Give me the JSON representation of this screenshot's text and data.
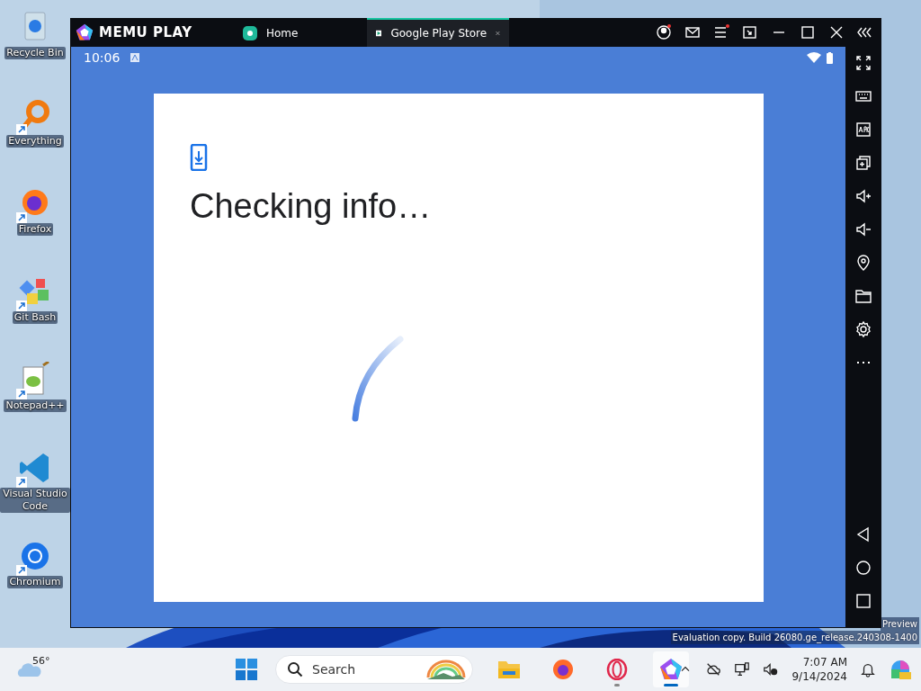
{
  "desktop_icons": [
    {
      "label": "Recycle Bin",
      "shortcut": false
    },
    {
      "label": "Everything",
      "shortcut": true
    },
    {
      "label": "Firefox",
      "shortcut": true
    },
    {
      "label": "Git Bash",
      "shortcut": true
    },
    {
      "label": "Notepad++",
      "shortcut": true
    },
    {
      "label": "Visual Studio Code",
      "shortcut": true
    },
    {
      "label": "Chromium",
      "shortcut": true
    }
  ],
  "window": {
    "logo": "MEMU PLAY",
    "tabs": [
      {
        "label": "Home",
        "selected": false,
        "closable": false
      },
      {
        "label": "Google Play Store",
        "selected": true,
        "closable": true
      }
    ],
    "android": {
      "time": "10:06",
      "dialog": {
        "title": "Checking info…"
      }
    }
  },
  "watermark_lines": [
    "Preview",
    "Evaluation copy. Build 26080.ge_release.240308-1400"
  ],
  "taskbar": {
    "weather": "56°",
    "search": {
      "placeholder": "Search"
    },
    "apps": [
      {
        "running": false,
        "active": false
      },
      {
        "running": false,
        "active": false
      },
      {
        "running": true,
        "active": false
      },
      {
        "running": true,
        "active": true
      }
    ],
    "time": "7:07 AM",
    "date": "9/14/2024"
  }
}
